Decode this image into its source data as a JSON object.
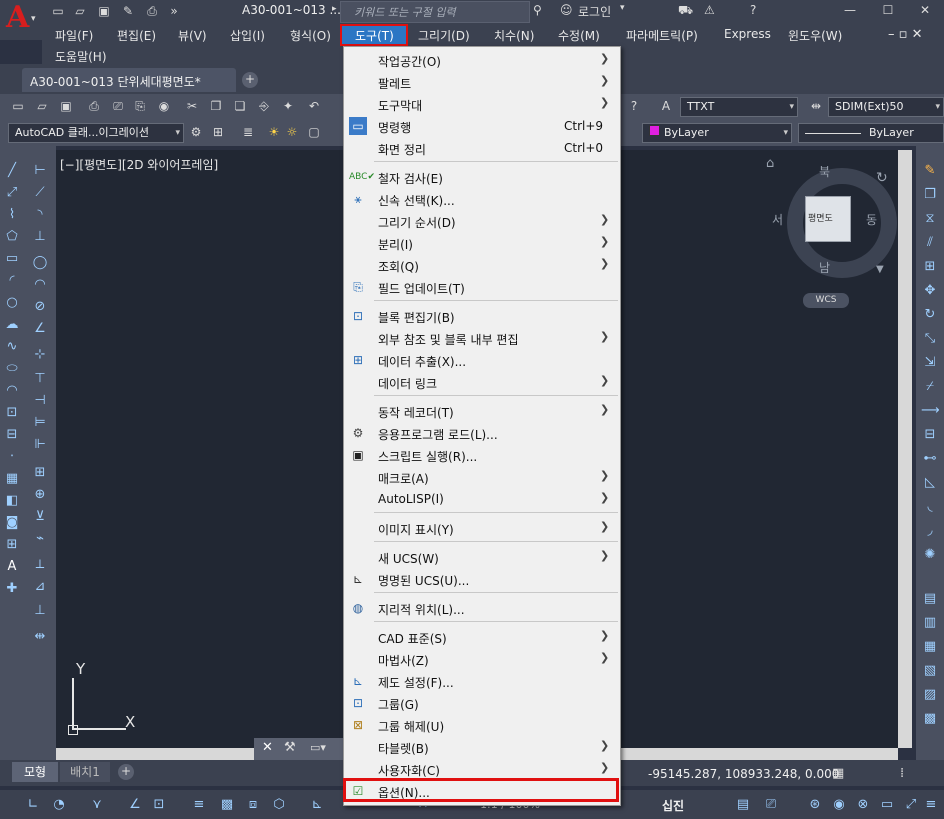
{
  "title_bar": {
    "document_title": "A30-001~013 ...",
    "search_placeholder": "키워드 또는 구절 입력",
    "login_label": "로그인",
    "minimize": "—",
    "maximize": "☐",
    "close": "✕"
  },
  "menubar": {
    "items": [
      "파일(F)",
      "편집(E)",
      "뷰(V)",
      "삽입(I)",
      "형식(O)",
      "도구(T)",
      "그리기(D)",
      "치수(N)",
      "수정(M)",
      "파라메트릭(P)",
      "Express",
      "윈도우(W)",
      "도움말(H)"
    ],
    "active": "도구(T)"
  },
  "doc_tab": {
    "label": "A30-001~013 단위세대평면도*",
    "plus": "+"
  },
  "toolbar": {
    "text_style": "TTXT",
    "dim_style": "SDIM(Ext)50",
    "workspace": "AutoCAD 클래...이그레이션",
    "color": "ByLayer",
    "linetype": "ByLayer"
  },
  "viewport": {
    "label": "[−][평면도][2D 와이어프레임]",
    "viewcube": {
      "north": "북",
      "south": "남",
      "east": "동",
      "west": "서",
      "face": "평면도"
    },
    "wcs": "WCS",
    "ucs_x": "X",
    "ucs_y": "Y"
  },
  "layout_tabs": {
    "model": "모형",
    "layout1": "배치1",
    "plus": "+"
  },
  "status": {
    "coords": "-95145.287, 108933.248, 0.000",
    "scale": "1:1 / 100%",
    "snap_label": "십진"
  },
  "dropdown": {
    "items": [
      {
        "label": "작업공간(O)",
        "shortcut": "",
        "submenu": true,
        "icon": ""
      },
      {
        "label": "팔레트",
        "shortcut": "",
        "submenu": true,
        "icon": ""
      },
      {
        "label": "도구막대",
        "shortcut": "",
        "submenu": true,
        "icon": ""
      },
      {
        "label": "명령행",
        "shortcut": "Ctrl+9",
        "submenu": false,
        "icon": "command-line-icon"
      },
      {
        "label": "화면 정리",
        "shortcut": "Ctrl+0",
        "submenu": false,
        "icon": ""
      },
      {
        "label": "철자 검사(E)",
        "shortcut": "",
        "submenu": false,
        "icon": "spell-check-icon"
      },
      {
        "label": "신속 선택(K)...",
        "shortcut": "",
        "submenu": false,
        "icon": "quick-select-icon"
      },
      {
        "label": "그리기 순서(D)",
        "shortcut": "",
        "submenu": true,
        "icon": ""
      },
      {
        "label": "분리(I)",
        "shortcut": "",
        "submenu": true,
        "icon": ""
      },
      {
        "label": "조회(Q)",
        "shortcut": "",
        "submenu": true,
        "icon": ""
      },
      {
        "label": "필드 업데이트(T)",
        "shortcut": "",
        "submenu": false,
        "icon": "update-field-icon"
      },
      {
        "label": "블록 편집기(B)",
        "shortcut": "",
        "submenu": false,
        "icon": "block-editor-icon"
      },
      {
        "label": "외부 참조 및 블록 내부 편집",
        "shortcut": "",
        "submenu": true,
        "icon": ""
      },
      {
        "label": "데이터 추출(X)...",
        "shortcut": "",
        "submenu": false,
        "icon": "data-extraction-icon"
      },
      {
        "label": "데이터 링크",
        "shortcut": "",
        "submenu": true,
        "icon": ""
      },
      {
        "label": "동작 레코더(T)",
        "shortcut": "",
        "submenu": true,
        "icon": ""
      },
      {
        "label": "응용프로그램 로드(L)...",
        "shortcut": "",
        "submenu": false,
        "icon": "load-application-icon"
      },
      {
        "label": "스크립트 실행(R)...",
        "shortcut": "",
        "submenu": false,
        "icon": "run-script-icon"
      },
      {
        "label": "매크로(A)",
        "shortcut": "",
        "submenu": true,
        "icon": ""
      },
      {
        "label": "AutoLISP(I)",
        "shortcut": "",
        "submenu": true,
        "icon": ""
      },
      {
        "label": "이미지 표시(Y)",
        "shortcut": "",
        "submenu": true,
        "icon": ""
      },
      {
        "label": "새 UCS(W)",
        "shortcut": "",
        "submenu": true,
        "icon": ""
      },
      {
        "label": "명명된 UCS(U)...",
        "shortcut": "",
        "submenu": false,
        "icon": "named-ucs-icon"
      },
      {
        "label": "지리적 위치(L)...",
        "shortcut": "",
        "submenu": false,
        "icon": "geographic-location-icon"
      },
      {
        "label": "CAD 표준(S)",
        "shortcut": "",
        "submenu": true,
        "icon": ""
      },
      {
        "label": "마법사(Z)",
        "shortcut": "",
        "submenu": true,
        "icon": ""
      },
      {
        "label": "제도 설정(F)...",
        "shortcut": "",
        "submenu": false,
        "icon": "drafting-settings-icon"
      },
      {
        "label": "그룹(G)",
        "shortcut": "",
        "submenu": false,
        "icon": "group-icon"
      },
      {
        "label": "그룹 해제(U)",
        "shortcut": "",
        "submenu": false,
        "icon": "ungroup-icon"
      },
      {
        "label": "타블렛(B)",
        "shortcut": "",
        "submenu": true,
        "icon": ""
      },
      {
        "label": "사용자화(C)",
        "shortcut": "",
        "submenu": true,
        "icon": ""
      },
      {
        "label": "옵션(N)...",
        "shortcut": "",
        "submenu": false,
        "icon": "options-check-icon"
      }
    ]
  },
  "colors": {
    "highlight_red": "#e01010",
    "menu_bg": "#f0f0f0",
    "canvas_bg": "#212733",
    "chrome_bg": "#3b4150"
  }
}
